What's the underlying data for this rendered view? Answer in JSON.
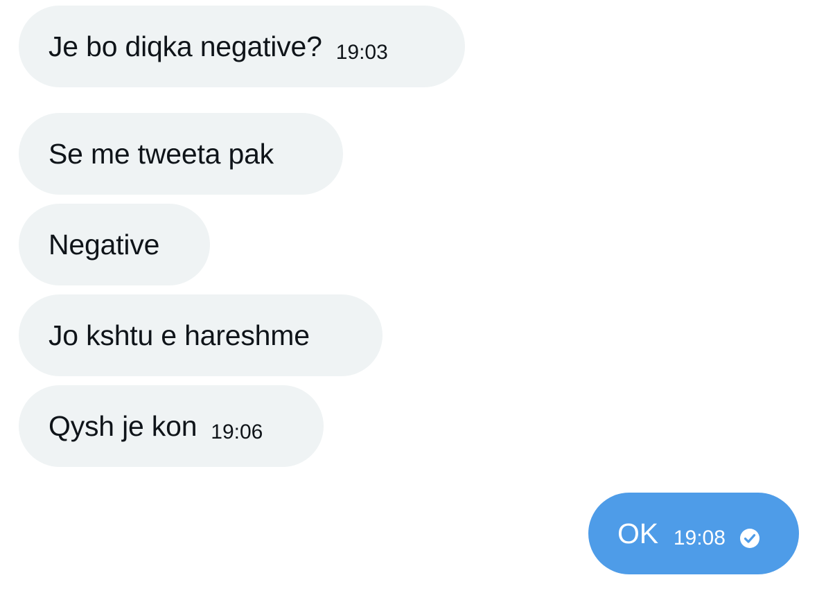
{
  "messages": [
    {
      "text": "Je bo diqka negative?",
      "time": "19:03"
    },
    {
      "text": "Se me tweeta pak",
      "time": ""
    },
    {
      "text": "Negative",
      "time": ""
    },
    {
      "text": "Jo kshtu e hareshme",
      "time": ""
    },
    {
      "text": "Qysh je kon",
      "time": "19:06"
    }
  ],
  "sent": {
    "text": "OK",
    "time": "19:08",
    "status_icon": "check-circle-icon"
  },
  "colors": {
    "incoming_bubble": "#eff3f4",
    "outgoing_bubble": "#4e9ce8",
    "text": "#0f1419"
  }
}
